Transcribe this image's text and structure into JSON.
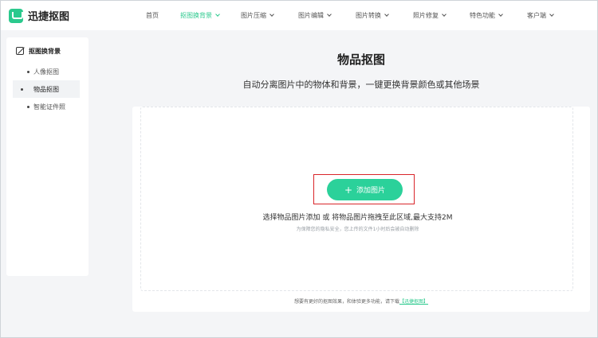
{
  "app": {
    "name": "迅捷抠图"
  },
  "nav": {
    "items": [
      {
        "label": "首页",
        "dropdown": false,
        "active": false
      },
      {
        "label": "抠图换背景",
        "dropdown": true,
        "active": true
      },
      {
        "label": "图片压缩",
        "dropdown": true,
        "active": false
      },
      {
        "label": "图片编辑",
        "dropdown": true,
        "active": false
      },
      {
        "label": "图片转换",
        "dropdown": true,
        "active": false
      },
      {
        "label": "照片修复",
        "dropdown": true,
        "active": false
      },
      {
        "label": "特色功能",
        "dropdown": true,
        "active": false
      },
      {
        "label": "客户端",
        "dropdown": true,
        "active": false
      }
    ]
  },
  "sidebar": {
    "header": "抠图换背景",
    "items": [
      {
        "label": "人像抠图",
        "active": false
      },
      {
        "label": "物品抠图",
        "active": true
      },
      {
        "label": "智能证件照",
        "active": false
      }
    ]
  },
  "main": {
    "title": "物品抠图",
    "subtitle": "自动分离图片中的物体和背景，一键更换背景颜色或其他场景",
    "upload": {
      "button_label": "添加图片",
      "button_icon": "plus-icon",
      "hint": "选择物品图片添加 或 将物品图片拖拽至此区域,最大支持2M",
      "privacy": "为保障您的隐私安全，您上传的文件1小时后会被自动删除"
    },
    "footer": {
      "text": "想要有更好的抠图效果，和体验更多功能，请下载",
      "link_label": "【迅捷抠图】"
    }
  },
  "colors": {
    "accent": "#2bc98d",
    "button": "#2bd19a",
    "highlight_border": "#d9252a"
  }
}
